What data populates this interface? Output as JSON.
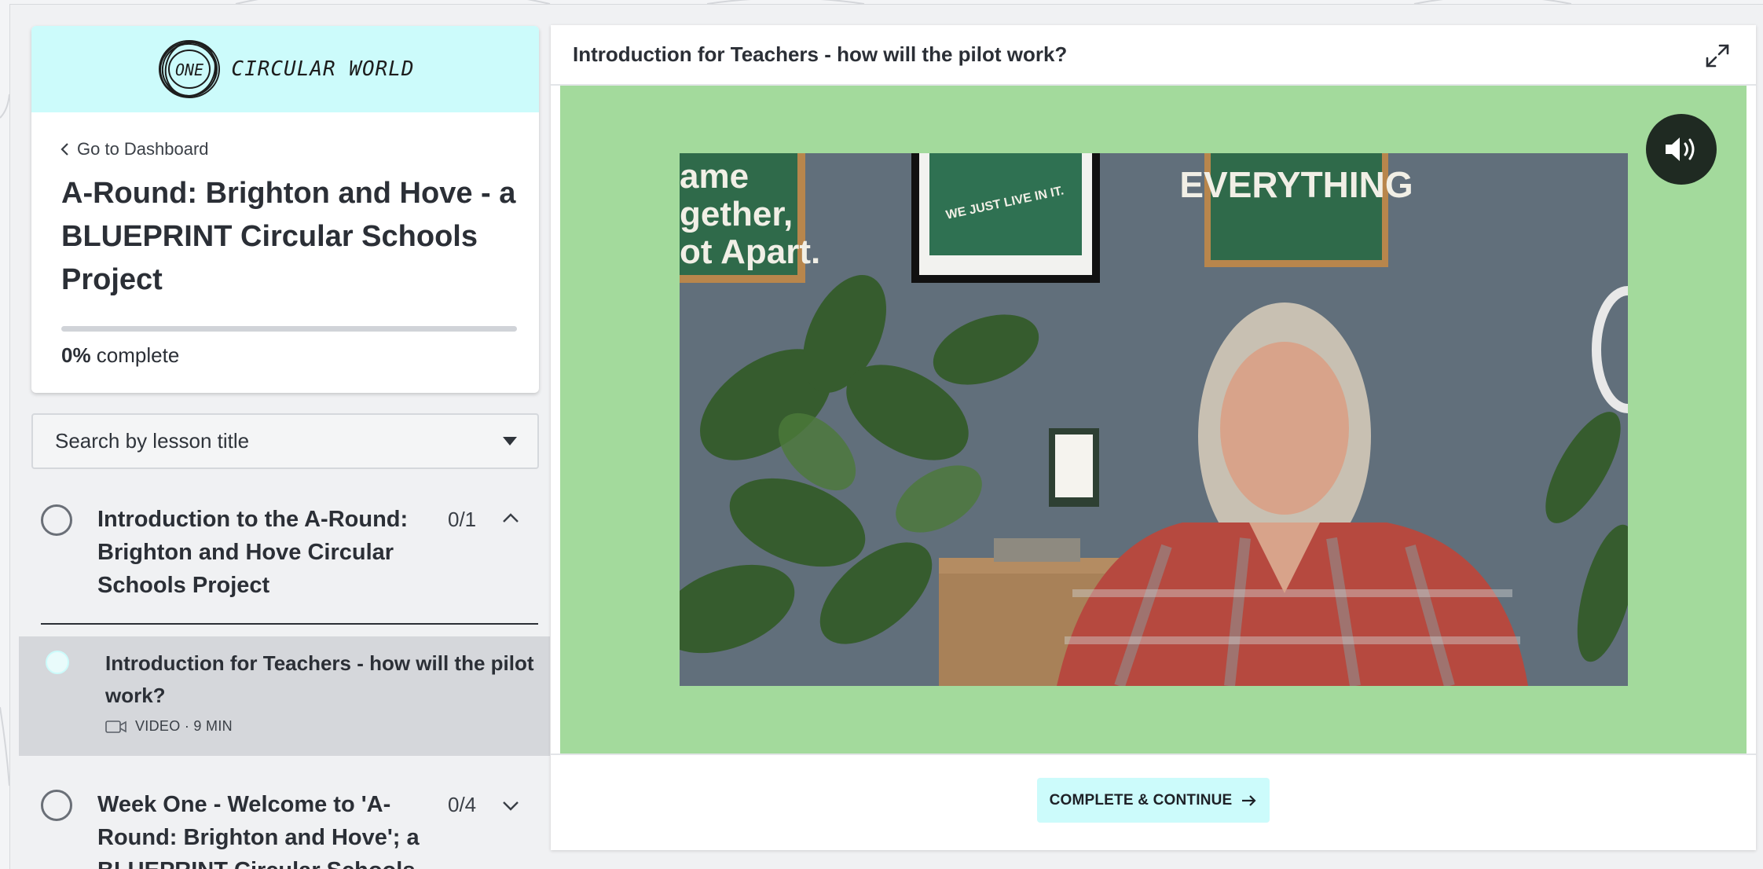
{
  "brand": {
    "logo_badge": "ONE",
    "logo_text": "CIRCULAR WORLD",
    "accent_color": "#ccfbfb"
  },
  "sidebar": {
    "back_link": "Go to Dashboard",
    "course_title": "A-Round: Brighton and Hove - a BLUEPRINT Circular Schools Project",
    "progress_percent": 0,
    "progress_value": "0%",
    "progress_suffix": " complete",
    "search_placeholder": "Search by lesson title",
    "chapters": [
      {
        "title": "Introduction to the A-Round: Brighton and Hove Circular Schools Project",
        "count": "0/1",
        "expanded": true,
        "lessons": [
          {
            "title": "Introduction for Teachers - how will the pilot work?",
            "meta": "VIDEO · 9 MIN",
            "icon": "video-camera-icon",
            "active": true
          }
        ]
      },
      {
        "title": "Week One - Welcome to 'A-Round: Brighton and Hove'; a BLUEPRINT Circular Schools",
        "count": "0/4",
        "expanded": false
      }
    ]
  },
  "main": {
    "lesson_title": "Introduction for Teachers - how will the pilot work?",
    "video": {
      "poster_text_1": "ame\ngether,\not Apart.",
      "poster_text_2": "WE JUST LIVE IN IT.",
      "poster_text_3": "EVERYTHING",
      "background_color": "#a3da9c"
    },
    "complete_button": "COMPLETE & CONTINUE"
  }
}
